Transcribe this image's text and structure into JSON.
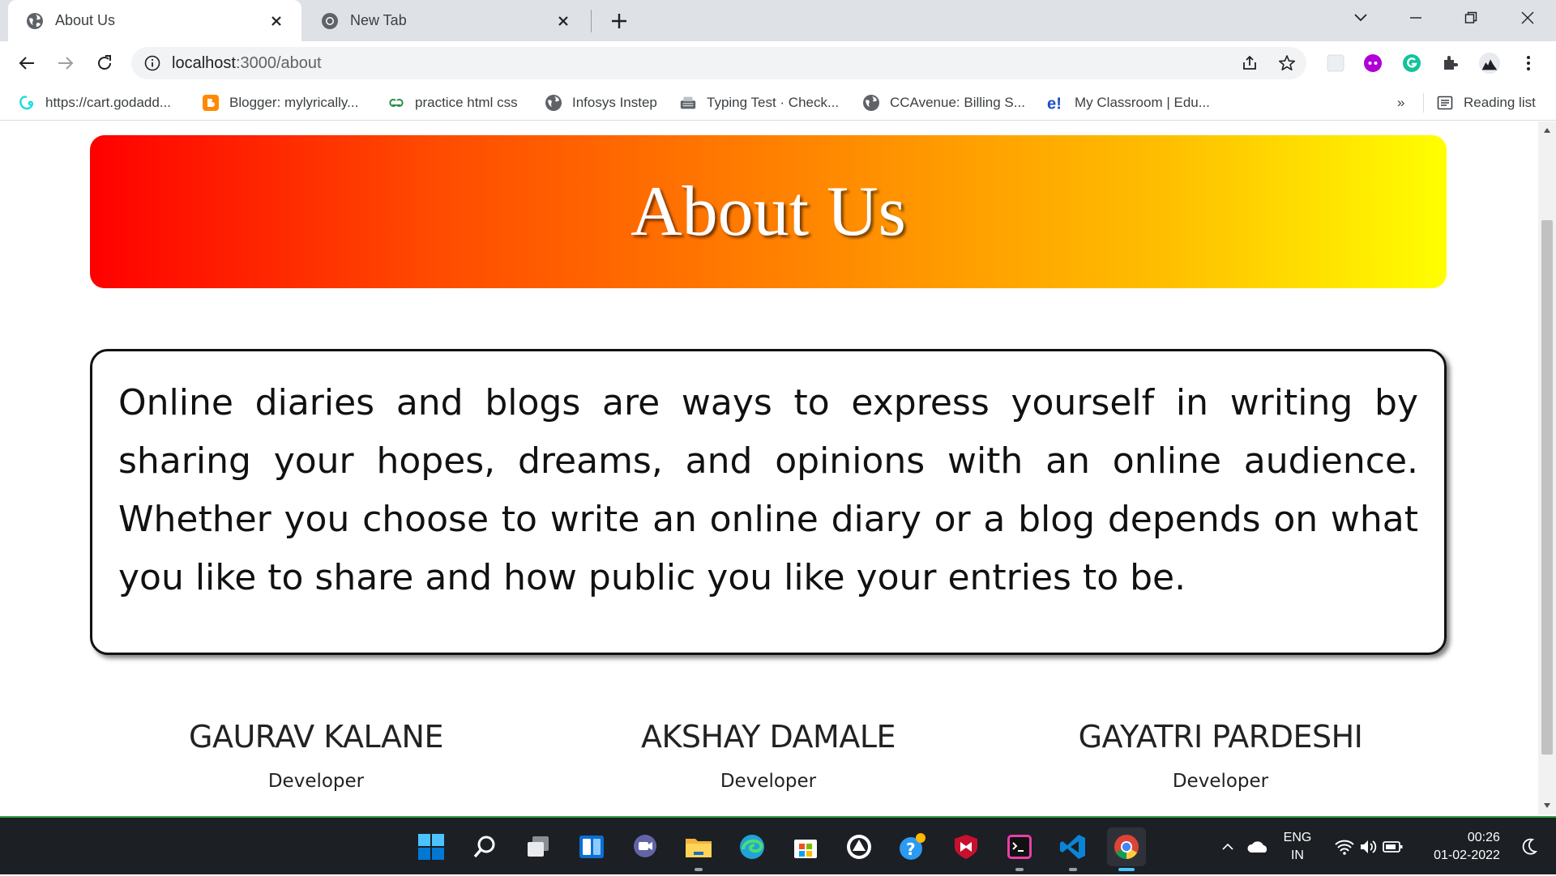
{
  "browser": {
    "tabs": [
      {
        "title": "About Us",
        "active": true
      },
      {
        "title": "New Tab",
        "active": false
      }
    ],
    "address": {
      "host": "localhost",
      "path": ":3000/about"
    },
    "bookmarks": [
      {
        "label": "https://cart.godadd...",
        "icon": "godaddy-icon"
      },
      {
        "label": "Blogger: mylyrically...",
        "icon": "blogger-icon"
      },
      {
        "label": "practice html css",
        "icon": "gfg-icon"
      },
      {
        "label": "Infosys Instep",
        "icon": "globe-icon"
      },
      {
        "label": "Typing Test · Check...",
        "icon": "typewriter-icon"
      },
      {
        "label": "CCAvenue: Billing S...",
        "icon": "globe-icon"
      },
      {
        "label": "My Classroom | Edu...",
        "icon": "edureka-icon"
      }
    ],
    "overflow_label": "»",
    "reading_list_label": "Reading list"
  },
  "page": {
    "hero_title": "About Us",
    "about_text": "Online diaries and blogs are ways to express yourself in writing by sharing your hopes, dreams, and opinions with an online audience. Whether you choose to write an online diary or a blog depends on what you like to share and how public you like your entries to be.",
    "team": [
      {
        "name": "GAURAV KALANE",
        "role": "Developer"
      },
      {
        "name": "AKSHAY DAMALE",
        "role": "Developer"
      },
      {
        "name": "GAYATRI PARDESHI",
        "role": "Developer"
      }
    ],
    "colors": {
      "gradient_start": "#ff0000",
      "gradient_end": "#ffff00"
    }
  },
  "taskbar": {
    "language_top": "ENG",
    "language_bottom": "IN",
    "time": "00:26",
    "date": "01-02-2022"
  }
}
